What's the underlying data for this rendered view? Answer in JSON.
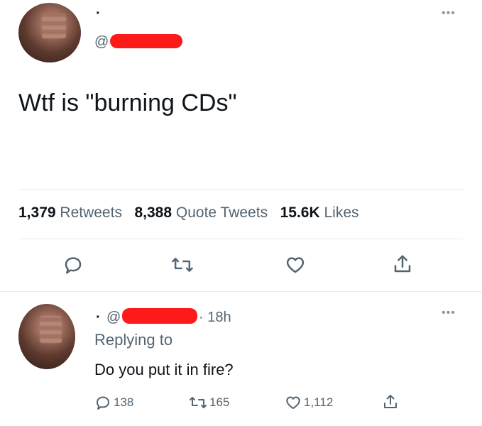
{
  "tweet": {
    "handle_prefix": "@",
    "top_dot": "·",
    "text": "Wtf is \"burning CDs\"",
    "stats": {
      "retweets_count": "1,379",
      "retweets_label": "Retweets",
      "quotes_count": "8,388",
      "quotes_label": "Quote Tweets",
      "likes_count": "15.6K",
      "likes_label": "Likes"
    },
    "more_icon": "more-dots-icon"
  },
  "actions": [
    "reply-icon",
    "retweet-icon",
    "like-icon",
    "share-icon"
  ],
  "reply": {
    "dot": "·",
    "handle_prefix": "@",
    "time": "· 18h",
    "replying_to": "Replying to",
    "text": "Do you put it in fire?",
    "counts": {
      "replies": "138",
      "retweets": "165",
      "likes": "1,112"
    }
  },
  "colors": {
    "text": "#0f1419",
    "muted": "#536471",
    "divider": "#e6ecf0",
    "redaction": "#ff1a1a"
  }
}
